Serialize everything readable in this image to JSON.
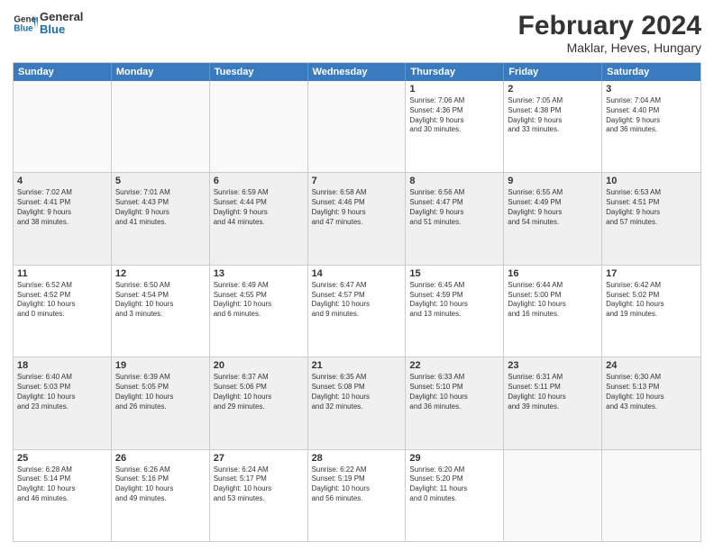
{
  "header": {
    "logo_line1": "General",
    "logo_line2": "Blue",
    "main_title": "February 2024",
    "subtitle": "Maklar, Heves, Hungary"
  },
  "days_of_week": [
    "Sunday",
    "Monday",
    "Tuesday",
    "Wednesday",
    "Thursday",
    "Friday",
    "Saturday"
  ],
  "rows": [
    [
      {
        "day": "",
        "info": ""
      },
      {
        "day": "",
        "info": ""
      },
      {
        "day": "",
        "info": ""
      },
      {
        "day": "",
        "info": ""
      },
      {
        "day": "1",
        "info": "Sunrise: 7:06 AM\nSunset: 4:36 PM\nDaylight: 9 hours\nand 30 minutes."
      },
      {
        "day": "2",
        "info": "Sunrise: 7:05 AM\nSunset: 4:38 PM\nDaylight: 9 hours\nand 33 minutes."
      },
      {
        "day": "3",
        "info": "Sunrise: 7:04 AM\nSunset: 4:40 PM\nDaylight: 9 hours\nand 36 minutes."
      }
    ],
    [
      {
        "day": "4",
        "info": "Sunrise: 7:02 AM\nSunset: 4:41 PM\nDaylight: 9 hours\nand 38 minutes."
      },
      {
        "day": "5",
        "info": "Sunrise: 7:01 AM\nSunset: 4:43 PM\nDaylight: 9 hours\nand 41 minutes."
      },
      {
        "day": "6",
        "info": "Sunrise: 6:59 AM\nSunset: 4:44 PM\nDaylight: 9 hours\nand 44 minutes."
      },
      {
        "day": "7",
        "info": "Sunrise: 6:58 AM\nSunset: 4:46 PM\nDaylight: 9 hours\nand 47 minutes."
      },
      {
        "day": "8",
        "info": "Sunrise: 6:56 AM\nSunset: 4:47 PM\nDaylight: 9 hours\nand 51 minutes."
      },
      {
        "day": "9",
        "info": "Sunrise: 6:55 AM\nSunset: 4:49 PM\nDaylight: 9 hours\nand 54 minutes."
      },
      {
        "day": "10",
        "info": "Sunrise: 6:53 AM\nSunset: 4:51 PM\nDaylight: 9 hours\nand 57 minutes."
      }
    ],
    [
      {
        "day": "11",
        "info": "Sunrise: 6:52 AM\nSunset: 4:52 PM\nDaylight: 10 hours\nand 0 minutes."
      },
      {
        "day": "12",
        "info": "Sunrise: 6:50 AM\nSunset: 4:54 PM\nDaylight: 10 hours\nand 3 minutes."
      },
      {
        "day": "13",
        "info": "Sunrise: 6:49 AM\nSunset: 4:55 PM\nDaylight: 10 hours\nand 6 minutes."
      },
      {
        "day": "14",
        "info": "Sunrise: 6:47 AM\nSunset: 4:57 PM\nDaylight: 10 hours\nand 9 minutes."
      },
      {
        "day": "15",
        "info": "Sunrise: 6:45 AM\nSunset: 4:59 PM\nDaylight: 10 hours\nand 13 minutes."
      },
      {
        "day": "16",
        "info": "Sunrise: 6:44 AM\nSunset: 5:00 PM\nDaylight: 10 hours\nand 16 minutes."
      },
      {
        "day": "17",
        "info": "Sunrise: 6:42 AM\nSunset: 5:02 PM\nDaylight: 10 hours\nand 19 minutes."
      }
    ],
    [
      {
        "day": "18",
        "info": "Sunrise: 6:40 AM\nSunset: 5:03 PM\nDaylight: 10 hours\nand 23 minutes."
      },
      {
        "day": "19",
        "info": "Sunrise: 6:39 AM\nSunset: 5:05 PM\nDaylight: 10 hours\nand 26 minutes."
      },
      {
        "day": "20",
        "info": "Sunrise: 6:37 AM\nSunset: 5:06 PM\nDaylight: 10 hours\nand 29 minutes."
      },
      {
        "day": "21",
        "info": "Sunrise: 6:35 AM\nSunset: 5:08 PM\nDaylight: 10 hours\nand 32 minutes."
      },
      {
        "day": "22",
        "info": "Sunrise: 6:33 AM\nSunset: 5:10 PM\nDaylight: 10 hours\nand 36 minutes."
      },
      {
        "day": "23",
        "info": "Sunrise: 6:31 AM\nSunset: 5:11 PM\nDaylight: 10 hours\nand 39 minutes."
      },
      {
        "day": "24",
        "info": "Sunrise: 6:30 AM\nSunset: 5:13 PM\nDaylight: 10 hours\nand 43 minutes."
      }
    ],
    [
      {
        "day": "25",
        "info": "Sunrise: 6:28 AM\nSunset: 5:14 PM\nDaylight: 10 hours\nand 46 minutes."
      },
      {
        "day": "26",
        "info": "Sunrise: 6:26 AM\nSunset: 5:16 PM\nDaylight: 10 hours\nand 49 minutes."
      },
      {
        "day": "27",
        "info": "Sunrise: 6:24 AM\nSunset: 5:17 PM\nDaylight: 10 hours\nand 53 minutes."
      },
      {
        "day": "28",
        "info": "Sunrise: 6:22 AM\nSunset: 5:19 PM\nDaylight: 10 hours\nand 56 minutes."
      },
      {
        "day": "29",
        "info": "Sunrise: 6:20 AM\nSunset: 5:20 PM\nDaylight: 11 hours\nand 0 minutes."
      },
      {
        "day": "",
        "info": ""
      },
      {
        "day": "",
        "info": ""
      }
    ]
  ]
}
